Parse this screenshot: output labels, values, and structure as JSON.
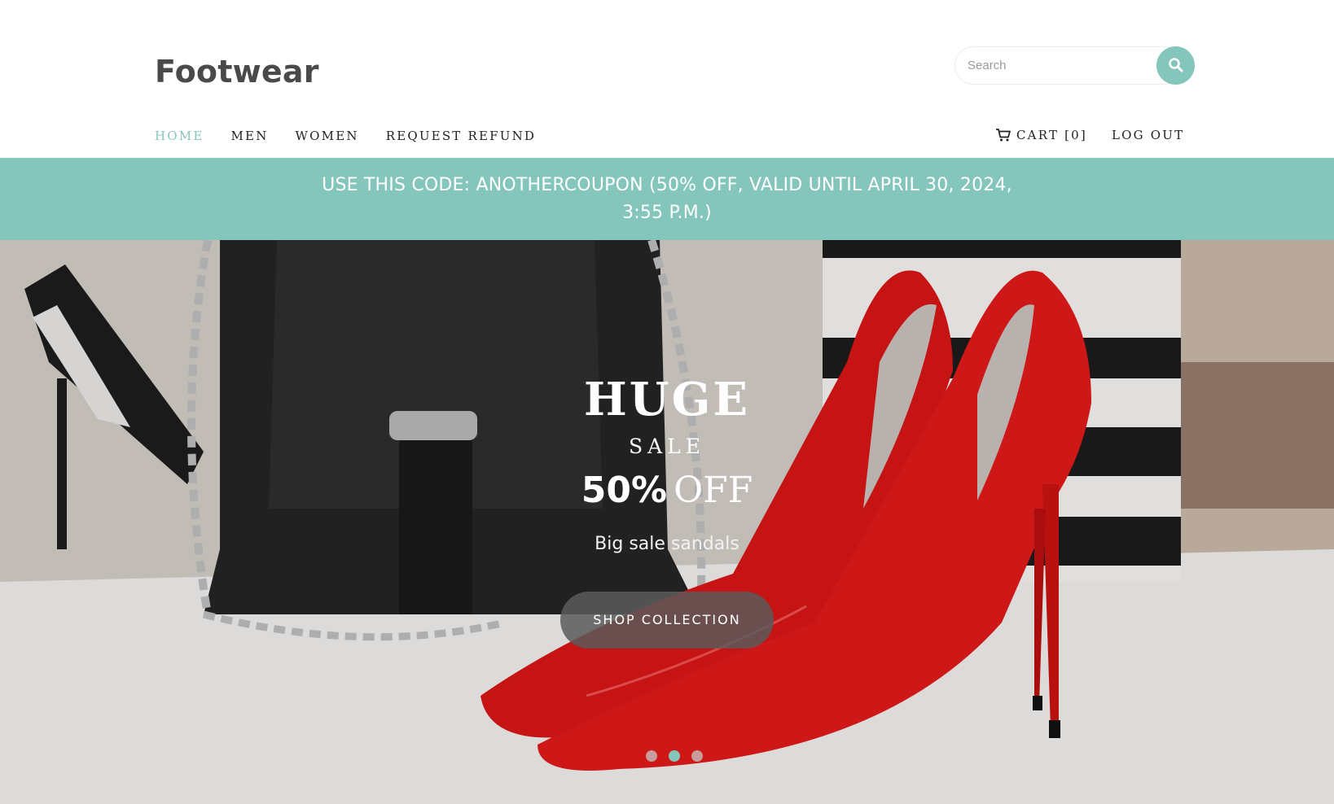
{
  "header": {
    "logo": "Footwear",
    "search": {
      "placeholder": "Search",
      "value": ""
    },
    "nav": [
      {
        "label": "HOME",
        "active": true
      },
      {
        "label": "MEN",
        "active": false
      },
      {
        "label": "WOMEN",
        "active": false
      },
      {
        "label": "REQUEST REFUND",
        "active": false
      }
    ],
    "cart_label": "CART [0]",
    "logout_label": "LOG OUT"
  },
  "coupon": {
    "text": "USE THIS CODE: ANOTHERCOUPON (50% OFF, VALID UNTIL APRIL 30, 2024, 3:55 P.M.)"
  },
  "hero": {
    "title": "HUGE",
    "subtitle": "SALE",
    "discount_pct": "50%",
    "discount_word": "OFF",
    "description": "Big sale sandals",
    "button_label": "SHOP COLLECTION",
    "slides": 3,
    "active_slide": 2
  },
  "colors": {
    "accent": "#84c6bb",
    "text_dark": "#222222",
    "logo": "#4a4a4a"
  },
  "icons": {
    "search": "search-icon",
    "cart": "cart-icon"
  }
}
